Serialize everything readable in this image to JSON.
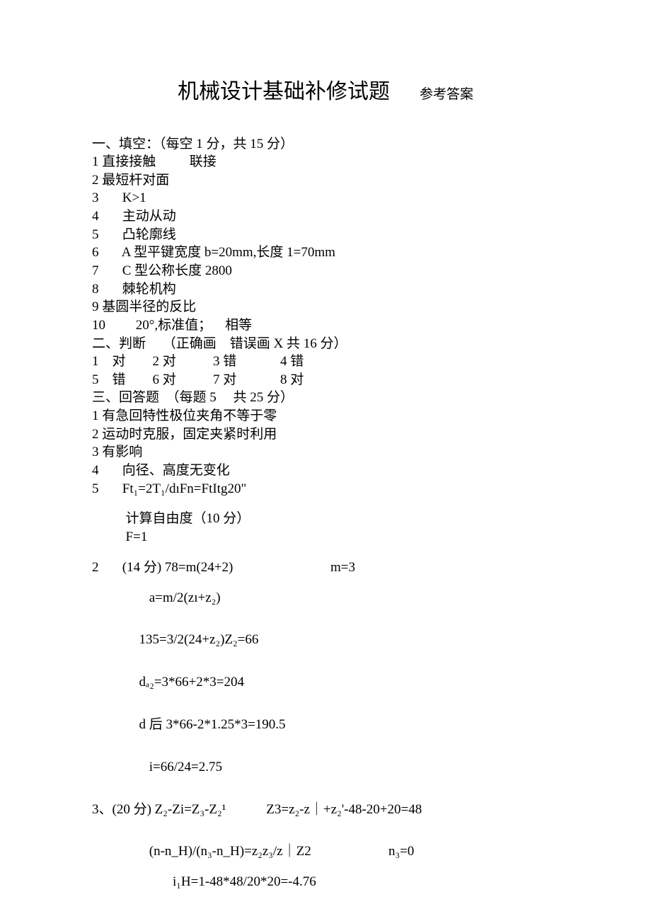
{
  "title": "机械设计基础补修试题",
  "subtitle": "参考答案",
  "lines": [
    "一、填空：（每空 1 分，共 15 分）",
    "1 直接接触          联接",
    "2 最短杆对面",
    "3       K>1",
    "4       主动从动",
    "5       凸轮廓线",
    "6       A 型平键宽度 b=20mm,长度 1=70mm",
    "7       C 型公称长度 2800",
    "8       棘轮机构",
    "9 基圆半径的反比",
    "10         20°,标准值；    相等",
    "二、判断     （正确画    错误画 X 共 16 分）",
    "1    对        2 对           3 错             4 错",
    "5    错        6 对           7 对             8 对",
    "三、回答题  （每题 5     共 25 分）",
    "1 有急回特性极位夹角不等于零",
    "2 运动时克服，固定夹紧时利用",
    "3 有影响",
    "4       向径、高度无变化",
    "5       Ft₁=2T₁/dıFn=FtItg20\"",
    "",
    "          计算自由度（10 分）",
    "          F=1",
    "",
    "2       (14 分) 78=m(24+2)                             m=3",
    "",
    "                 a=m/2(zı+z₂)",
    "",
    "",
    "              135=3/2(24+z₂)Z₂=66",
    "",
    "",
    "              dₐ₂=3*66+2*3=204",
    "",
    "",
    "              d 后 3*66-2*1.25*3=190.5",
    "",
    "",
    "                 i=66/24=2.75",
    "",
    "",
    "3、(20 分) Z₂-Zi=Z₃-Z₂¹            Z3=z₂-z｜+z₂'-48-20+20=48",
    "",
    "",
    "                 (n-n_H)/(n₃-n_H)=z₂z₃/z｜Z2                       n₃=0",
    "",
    "                        i₁H=1-48*48/20*20=-4.76"
  ]
}
